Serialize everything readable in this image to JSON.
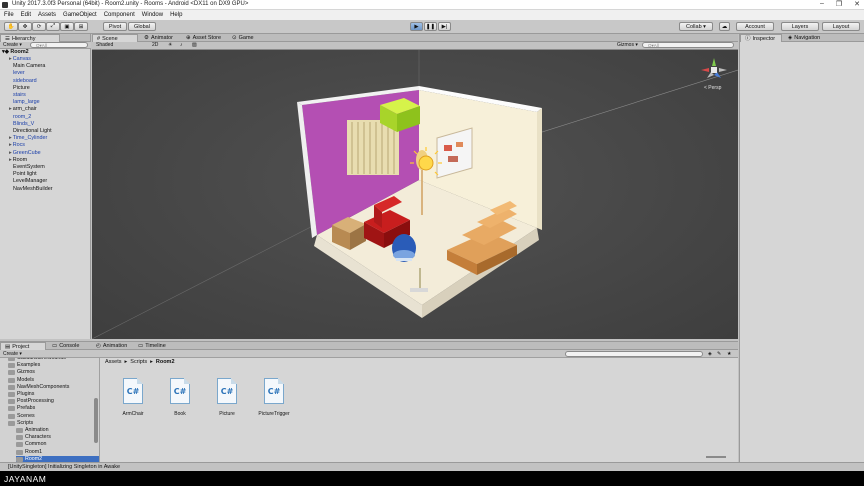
{
  "window": {
    "title": "Unity 2017.3.0f3 Personal (64bit) - Room2.unity - Rooms - Android <DX11 on DX9 GPU>",
    "controls": [
      "–",
      "❐",
      "✕"
    ]
  },
  "menu": [
    "File",
    "Edit",
    "Assets",
    "GameObject",
    "Component",
    "Window",
    "Help"
  ],
  "toolbar": {
    "pivot": "Pivot",
    "global": "Global",
    "collab": "Collab ▾",
    "account": "Account",
    "layers": "Layers",
    "layout": "Layout"
  },
  "hierarchy": {
    "tab": "Hierarchy",
    "create": "Create ▾",
    "search": "Q▾All",
    "scene": "Room2",
    "items": [
      {
        "label": "Canvas",
        "blue": true,
        "arrow": true
      },
      {
        "label": "Main Camera",
        "blue": false
      },
      {
        "label": "lever",
        "blue": true
      },
      {
        "label": "sideboard",
        "blue": true
      },
      {
        "label": "Picture",
        "blue": false
      },
      {
        "label": "stairs",
        "blue": true
      },
      {
        "label": "lamp_large",
        "blue": true
      },
      {
        "label": "arm_chair",
        "blue": false,
        "arrow": true
      },
      {
        "label": "room_2",
        "blue": true
      },
      {
        "label": "Blinds_V",
        "blue": true
      },
      {
        "label": "Directional Light",
        "blue": false
      },
      {
        "label": "Time_Cylinder",
        "blue": true,
        "arrow": true
      },
      {
        "label": "Rocs",
        "blue": true,
        "arrow": true
      },
      {
        "label": "GreenCube",
        "blue": true,
        "arrow": true
      },
      {
        "label": "Room",
        "blue": false,
        "arrow": true
      },
      {
        "label": "EventSystem",
        "blue": false
      },
      {
        "label": "Point light",
        "blue": false
      },
      {
        "label": "LevelManager",
        "blue": false
      },
      {
        "label": "NavMeshBuilder",
        "blue": false
      }
    ]
  },
  "scene": {
    "tabs": [
      "Scene",
      "Animator",
      "Asset Store",
      "Game"
    ],
    "shading": "Shaded",
    "mode2d": "2D",
    "gizmos": "Gizmos ▾",
    "search": "Q▾All",
    "persp": "< Persp"
  },
  "inspector": {
    "tabs": [
      "Inspector",
      "Navigation"
    ]
  },
  "project": {
    "tabs": [
      "Project",
      "Console",
      "Animation",
      "Timeline"
    ],
    "create": "Create ▾",
    "breadcrumb": [
      "Assets",
      "Scripts",
      "Room2"
    ],
    "folders": [
      {
        "label": "CasualGameSounds",
        "indent": 1
      },
      {
        "label": "Examples",
        "indent": 1
      },
      {
        "label": "Gizmos",
        "indent": 1
      },
      {
        "label": "Models",
        "indent": 1
      },
      {
        "label": "NavMeshComponents",
        "indent": 1
      },
      {
        "label": "Plugins",
        "indent": 1
      },
      {
        "label": "PostProcessing",
        "indent": 1
      },
      {
        "label": "Prefabs",
        "indent": 1
      },
      {
        "label": "Scenes",
        "indent": 1
      },
      {
        "label": "Scripts",
        "indent": 1
      },
      {
        "label": "Animation",
        "indent": 2
      },
      {
        "label": "Characters",
        "indent": 2
      },
      {
        "label": "Common",
        "indent": 2
      },
      {
        "label": "Room1",
        "indent": 2
      },
      {
        "label": "Room2",
        "indent": 2,
        "selected": true
      }
    ],
    "assets": [
      {
        "icon": "C#",
        "name": "ArmChair"
      },
      {
        "icon": "C#",
        "name": "Book"
      },
      {
        "icon": "C#",
        "name": "Picture"
      },
      {
        "icon": "C#",
        "name": "PictureTrigger"
      }
    ]
  },
  "status": "[UnitySingleton] Initializing Singleton in Awake",
  "watermark": "JAYANAM"
}
